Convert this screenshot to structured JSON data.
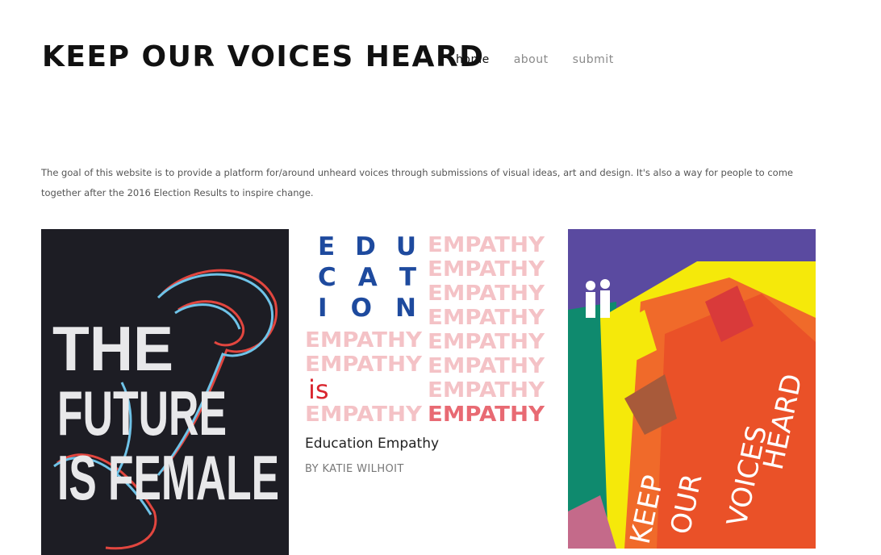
{
  "site": {
    "title": "KEEP OUR VOICES HEARD"
  },
  "nav": {
    "items": [
      "home",
      "about",
      "submit"
    ],
    "active": "home"
  },
  "intro": "The goal of this website is to provide a platform for/around unheard voices through submissions of visual ideas, art and design. It's also a way for people to come together after the 2016 Election Results to inspire change.",
  "gallery": [
    {
      "lines": [
        "THE",
        "FUTURE",
        "IS FEMALE"
      ]
    },
    {
      "title": "Education Empathy",
      "author": "BY KATIE WILHOIT",
      "art": {
        "edu": [
          "E D U",
          "C A T",
          "I O N"
        ],
        "word": "EMPATHY",
        "is": "is"
      }
    },
    {
      "lines": [
        "KEEP",
        "OUR",
        "VOICES",
        "HEARD"
      ]
    }
  ],
  "colors": {
    "accent_blue": "#1e4a9e",
    "empathy_pink": "#f4c2c6",
    "empathy_red": "#e86a73",
    "poster_dark": "#1d1d24"
  }
}
